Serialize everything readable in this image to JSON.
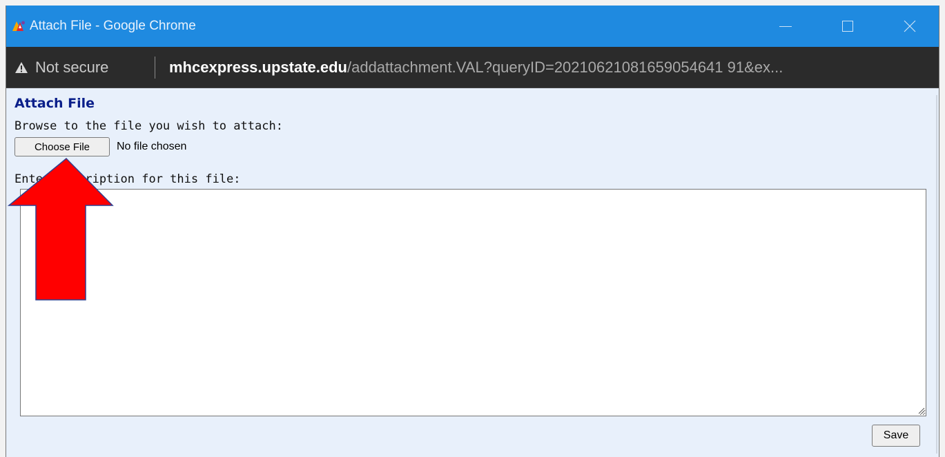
{
  "window": {
    "title": "Attach File - Google Chrome"
  },
  "addressbar": {
    "security_label": "Not secure",
    "url_host": "mhcexpress.upstate.edu",
    "url_path": "/addattachment.VAL?queryID=20210621081659054641 91&ex..."
  },
  "page": {
    "heading": "Attach File",
    "browse_label": "Browse to the file you wish to attach:",
    "choose_button": "Choose File",
    "file_status": "No file chosen",
    "description_label": "Enter description for this file:",
    "description_value": "",
    "save_button": "Save"
  },
  "colors": {
    "titlebar": "#1f8ae0",
    "addressbar": "#2b2b2b",
    "page_background": "#e8f0fb",
    "heading": "#0a1f8a",
    "annotation_arrow": "#ff0000"
  },
  "icons": {
    "app": "app-logo-icon",
    "warning": "warning-triangle-icon",
    "minimize": "minimize-icon",
    "maximize": "maximize-icon",
    "close": "close-icon",
    "annotation": "red-up-arrow-icon"
  }
}
